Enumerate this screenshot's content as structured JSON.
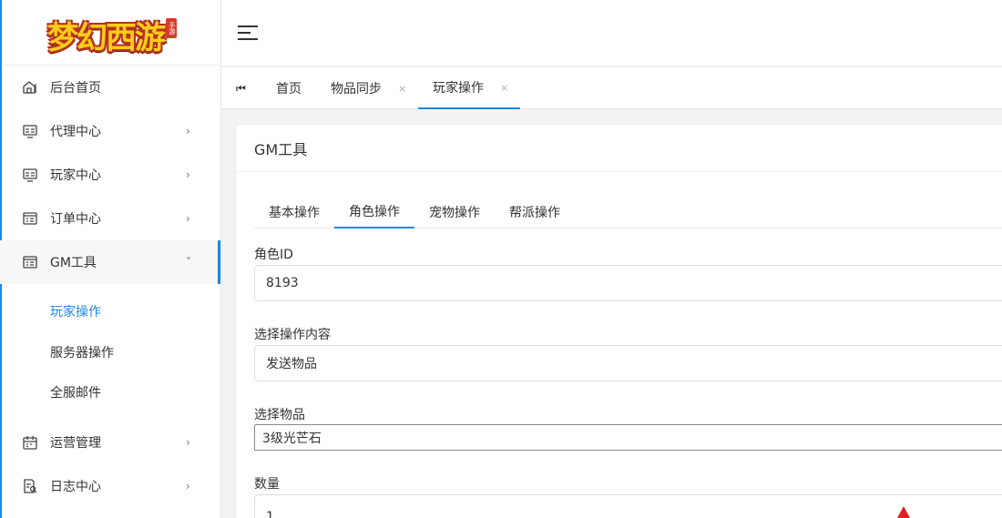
{
  "logo": {
    "text": "梦幻西游",
    "seal": "手游"
  },
  "sidebar": {
    "items": [
      {
        "label": "后台首页",
        "icon": "home-icon"
      },
      {
        "label": "代理中心",
        "icon": "card-icon",
        "chevron": "›"
      },
      {
        "label": "玩家中心",
        "icon": "card-icon",
        "chevron": "›"
      },
      {
        "label": "订单中心",
        "icon": "list-icon",
        "chevron": "›"
      },
      {
        "label": "GM工具",
        "icon": "list-icon",
        "chevron": "˅"
      },
      {
        "label": "运营管理",
        "icon": "calendar-icon",
        "chevron": "›"
      },
      {
        "label": "日志中心",
        "icon": "log-icon",
        "chevron": "›"
      }
    ],
    "submenu": [
      "玩家操作",
      "服务器操作",
      "全服邮件"
    ]
  },
  "tabstrip": {
    "first_icon": "⏮",
    "tabs": [
      {
        "label": "首页"
      },
      {
        "label": "物品同步",
        "close": "×"
      },
      {
        "label": "玩家操作",
        "close": "×"
      }
    ]
  },
  "card": {
    "title": "GM工具",
    "tabs": [
      "基本操作",
      "角色操作",
      "宠物操作",
      "帮派操作"
    ],
    "fields": [
      {
        "label": "角色ID",
        "value": "8193"
      },
      {
        "label": "选择操作内容",
        "value": "发送物品"
      },
      {
        "label": "选择物品",
        "value": "3级光芒石"
      },
      {
        "label": "数量",
        "value": "1"
      }
    ]
  },
  "colors": {
    "accent": "#1e88e5",
    "text": "#333333",
    "background": "#f2f3f5"
  }
}
